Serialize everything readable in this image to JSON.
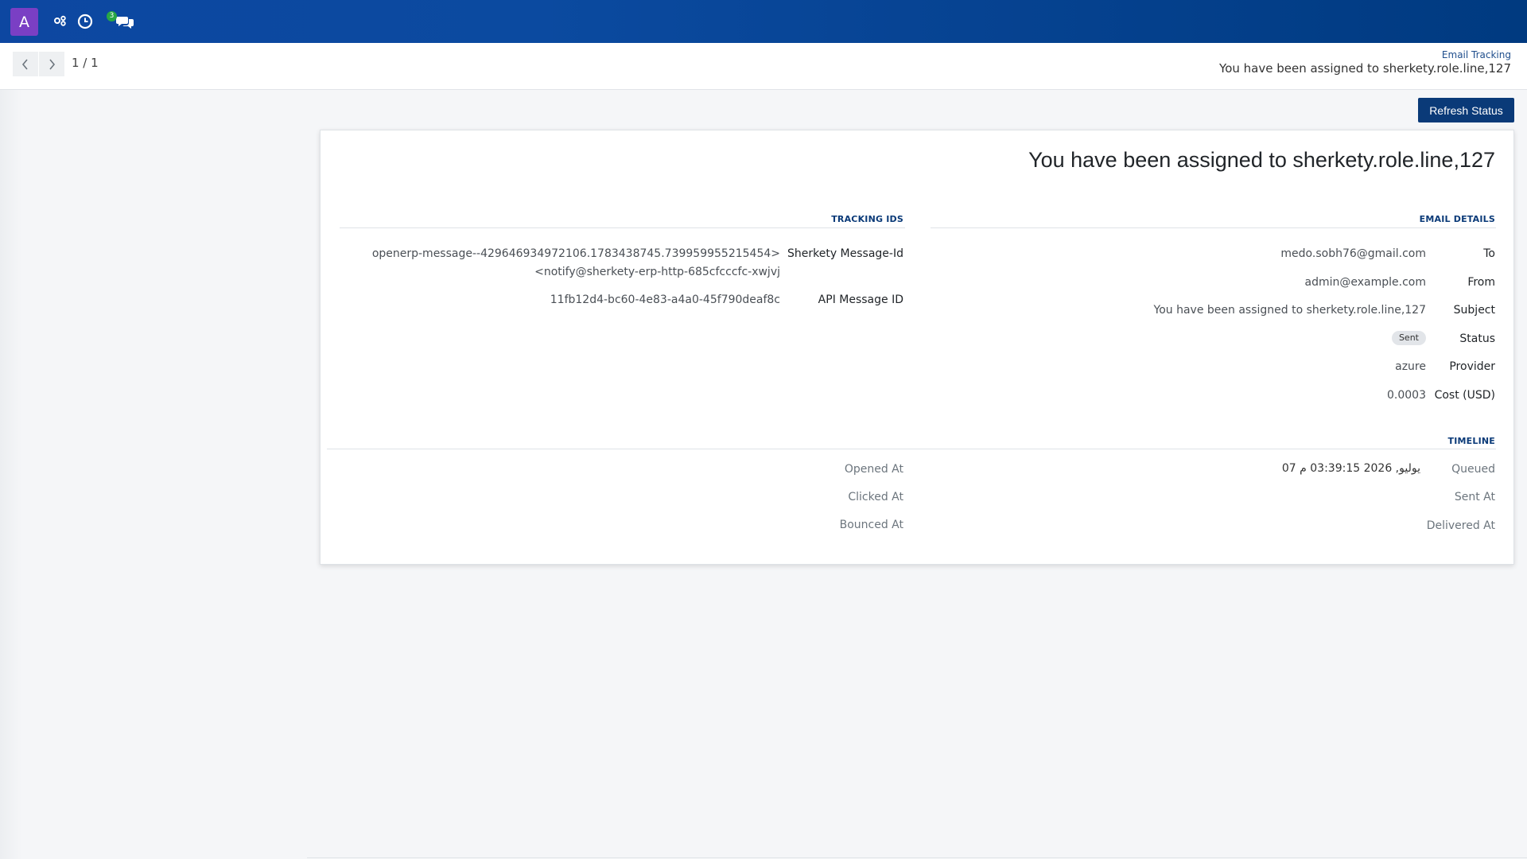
{
  "topbar": {
    "avatar_letter": "A",
    "icons": [
      "users-gear-icon",
      "clock-icon",
      "chat-icon"
    ],
    "chat_badge": "3"
  },
  "pager": {
    "value": "1 / 1"
  },
  "breadcrumb": {
    "parent": "Email Tracking",
    "current": "You have been assigned to sherkety.role.line,127"
  },
  "actions": {
    "refresh_label": "Refresh Status"
  },
  "record": {
    "title": "You have been assigned to sherkety.role.line,127",
    "email_details": {
      "heading": "EMAIL DETAILS",
      "to_label": "To",
      "to_value": "medo.sobh76@gmail.com",
      "from_label": "From",
      "from_value": "admin@example.com",
      "subject_label": "Subject",
      "subject_value": "You have been assigned to sherkety.role.line,127",
      "status_label": "Status",
      "status_value": "Sent",
      "provider_label": "Provider",
      "provider_value": "azure",
      "cost_label": "Cost (USD)",
      "cost_value": "0.0003"
    },
    "tracking_ids": {
      "heading": "TRACKING IDS",
      "message_id_label": "Sherkety Message-Id",
      "message_id_line1": "openerp-message--429646934972106.1783438745.739959955215454>",
      "message_id_line2": "<notify@sherkety-erp-http-685cfcccfc-xwjvj",
      "api_id_label": "API Message ID",
      "api_id_value": "11fb12d4-bc60-4e83-a4a0-45f790deaf8c"
    },
    "timeline": {
      "heading": "TIMELINE",
      "queued_label": "Queued",
      "queued_value": "07 يوليو, 2026 03:39:15 م",
      "sent_label": "Sent At",
      "delivered_label": "Delivered At",
      "opened_label": "Opened At",
      "clicked_label": "Clicked At",
      "bounced_label": "Bounced At"
    }
  }
}
